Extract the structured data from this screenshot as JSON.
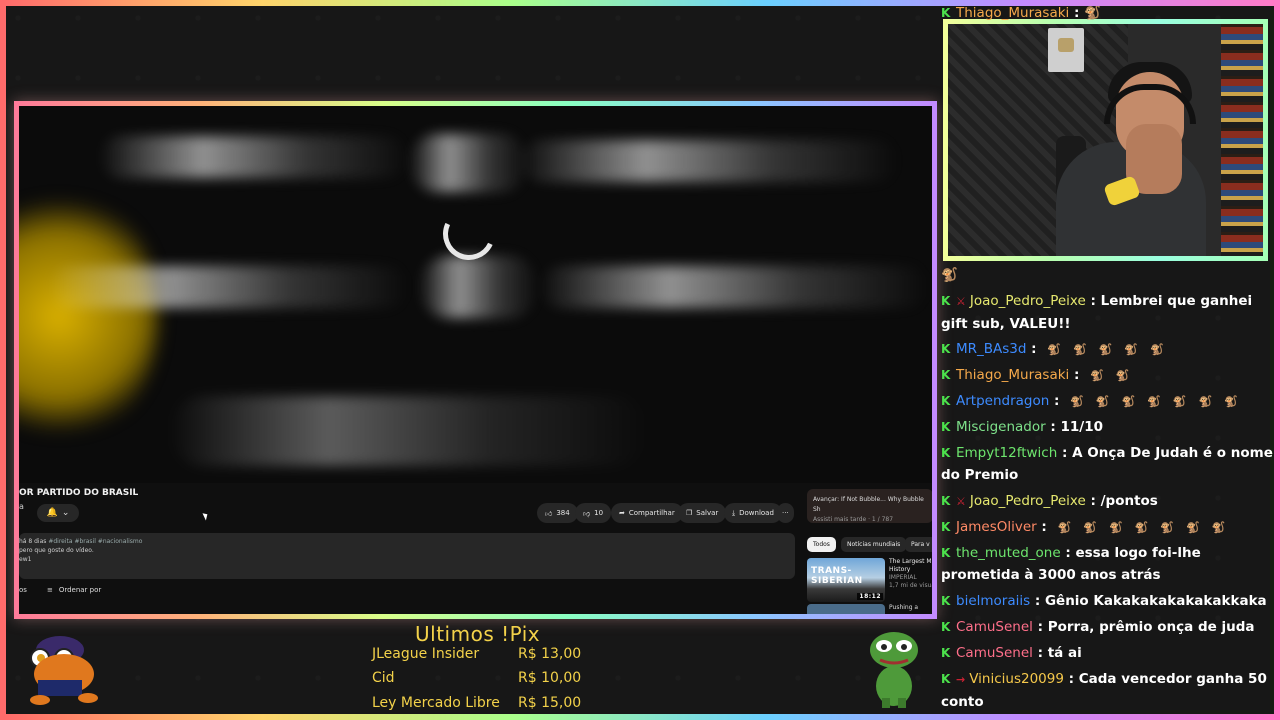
{
  "video": {
    "title": "OR PARTIDO DO BRASIL",
    "like_count": "384",
    "dislike_count": "10",
    "share_label": "Compartilhar",
    "save_label": "Salvar",
    "download_label": "Download",
    "more_label": "···",
    "desc_meta": "há 8 dias",
    "desc_tags": "#direita #brasil #nacionalismo",
    "desc_line2": "pero que goste do vídeo.",
    "desc_line3": "ew1",
    "sort_prefix": "os",
    "sort_label": "Ordenar por",
    "channel_initial": "a",
    "up_next_title": "Avançar: If Not Bubble... Why Bubble Sh",
    "up_next_sub": "Assisti mais tarde · 1 / 787",
    "chips": [
      "Todos",
      "Notícias mundiais",
      "Para v"
    ],
    "reco_thumb_text": "TRANS-SIBERIAN",
    "reco_duration": "18:12",
    "reco_title": "The Largest M History",
    "reco_channel": "IMPERIAL",
    "reco_views": "1,7 mi de visuali",
    "reco2_title": "Pushing a"
  },
  "chat": [
    {
      "user": "Thiago_Murasaki",
      "color": "#f5a94b",
      "text": " : 🐒",
      "badge": "K"
    },
    {
      "user": "",
      "color": "#ffffff",
      "text": "🐒",
      "badge": ""
    },
    {
      "user": "Joao_Pedro_Peixe",
      "color": "#e6e86f",
      "text": " : Lembrei que ganhei gift sub, VALEU!!",
      "badge": "K",
      "mini": "⚔"
    },
    {
      "user": "MR_BAs3d",
      "color": "#3d8bff",
      "text": " : ",
      "badge": "K",
      "emotes": 5
    },
    {
      "user": "Thiago_Murasaki",
      "color": "#f5a94b",
      "text": " : ",
      "badge": "K",
      "emotes": 2
    },
    {
      "user": "Artpendragon",
      "color": "#3d8bff",
      "text": " : ",
      "badge": "K",
      "emotes": 7
    },
    {
      "user": "Miscigenador",
      "color": "#7ee08a",
      "text": " : 11/10",
      "badge": "K"
    },
    {
      "user": "Empyt12ftwich",
      "color": "#6ee66e",
      "text": " : A Onça De Judah é o nome do Premio",
      "badge": "K"
    },
    {
      "user": "Joao_Pedro_Peixe",
      "color": "#e6e86f",
      "text": " : /pontos",
      "badge": "K",
      "mini": "⚔"
    },
    {
      "user": "JamesOliver",
      "color": "#ff8a66",
      "text": " : ",
      "badge": "K",
      "emotes": 7
    },
    {
      "user": "the_muted_one",
      "color": "#6ee66e",
      "text": " : essa logo foi-lhe prometida à 3000 anos atrás",
      "badge": "K"
    },
    {
      "user": "bielmoraiis",
      "color": "#3d8bff",
      "text": " : Gênio Kakakakakakakakkaka",
      "badge": "K"
    },
    {
      "user": "CamuSenel",
      "color": "#ff6f8a",
      "text": " : Porra, prêmio onça de juda",
      "badge": "K"
    },
    {
      "user": "CamuSenel",
      "color": "#ff6f8a",
      "text": " : tá ai",
      "badge": "K"
    },
    {
      "user": "Vinicius20099",
      "color": "#f5c84b",
      "text": " : Cada vencedor ganha 50 conto",
      "badge": "K",
      "mini": "→"
    }
  ],
  "pix": {
    "title": "Ultimos !Pix",
    "rows": [
      {
        "name": "JLeague Insider",
        "amount": "R$ 13,00"
      },
      {
        "name": "Cid",
        "amount": "R$ 10,00"
      },
      {
        "name": "Ley Mercado Libre",
        "amount": "R$ 15,00"
      }
    ]
  },
  "colors": {
    "pix_text": "#f3d24a",
    "chat_badge": "#4ce24c"
  }
}
